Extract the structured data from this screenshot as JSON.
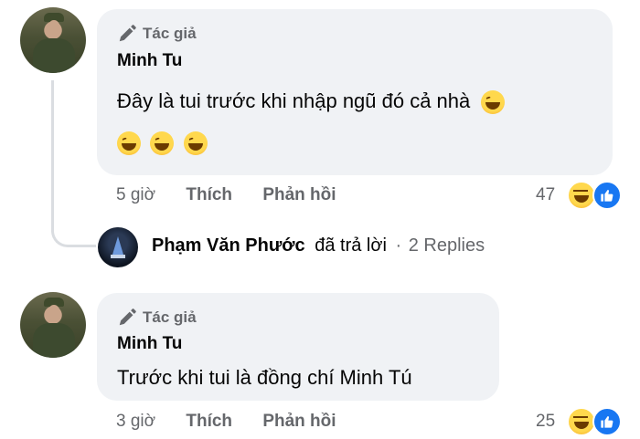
{
  "comments": [
    {
      "badge": "Tác giả",
      "author": "Minh Tu",
      "text": "Đây là tui trước khi nhập ngũ đó cả nhà",
      "emoji_icon": "laughing-tears-emoji",
      "time": "5 giờ",
      "like_label": "Thích",
      "reply_label": "Phản hồi",
      "reaction_count": "47",
      "reactions": [
        "haha-icon",
        "like-icon"
      ]
    },
    {
      "badge": "Tác giả",
      "author": "Minh Tu",
      "text": "Trước khi tui là đồng chí Minh Tú",
      "time": "3 giờ",
      "like_label": "Thích",
      "reply_label": "Phản hồi",
      "reaction_count": "25",
      "reactions": [
        "haha-icon",
        "like-icon"
      ]
    }
  ],
  "reply_summary": {
    "name": "Phạm Văn Phước",
    "action": "đã trả lời",
    "separator": "·",
    "replies": "2 Replies"
  },
  "colors": {
    "bubble": "#f0f2f5",
    "meta": "#65676b",
    "like_blue": "#1877f2"
  }
}
